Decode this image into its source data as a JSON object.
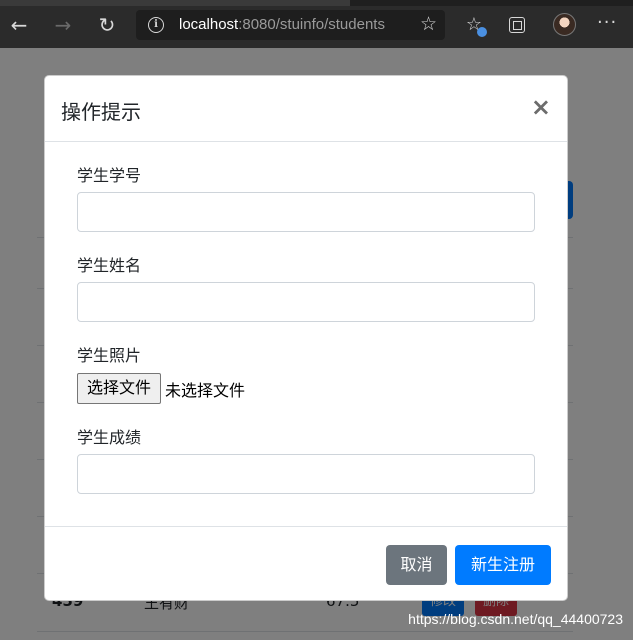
{
  "browser": {
    "url_host": "localhost",
    "url_rest": ":8080/stuinfo/students",
    "icons": [
      "back-arrow-icon",
      "forward-arrow-icon",
      "refresh-icon",
      "info-icon",
      "star-icon",
      "favorites-icon",
      "collections-icon",
      "avatar",
      "more-icon"
    ]
  },
  "background_page": {
    "rows": [
      {
        "id": "459",
        "name": "王有财",
        "score": "67.5"
      }
    ],
    "edit_label": "修改",
    "delete_label": "删除"
  },
  "modal": {
    "title": "操作提示",
    "close_symbol": "×",
    "fields": {
      "student_id_label": "学生学号",
      "student_name_label": "学生姓名",
      "student_photo_label": "学生照片",
      "student_score_label": "学生成绩"
    },
    "file_button_label": "选择文件",
    "file_status": "未选择文件",
    "cancel_label": "取消",
    "submit_label": "新生注册"
  },
  "watermark": "https://blog.csdn.net/qq_44400723",
  "colors": {
    "primary": "#007bff",
    "secondary": "#6c757d",
    "danger": "#dc3545",
    "chrome": "#2b2b2b"
  }
}
